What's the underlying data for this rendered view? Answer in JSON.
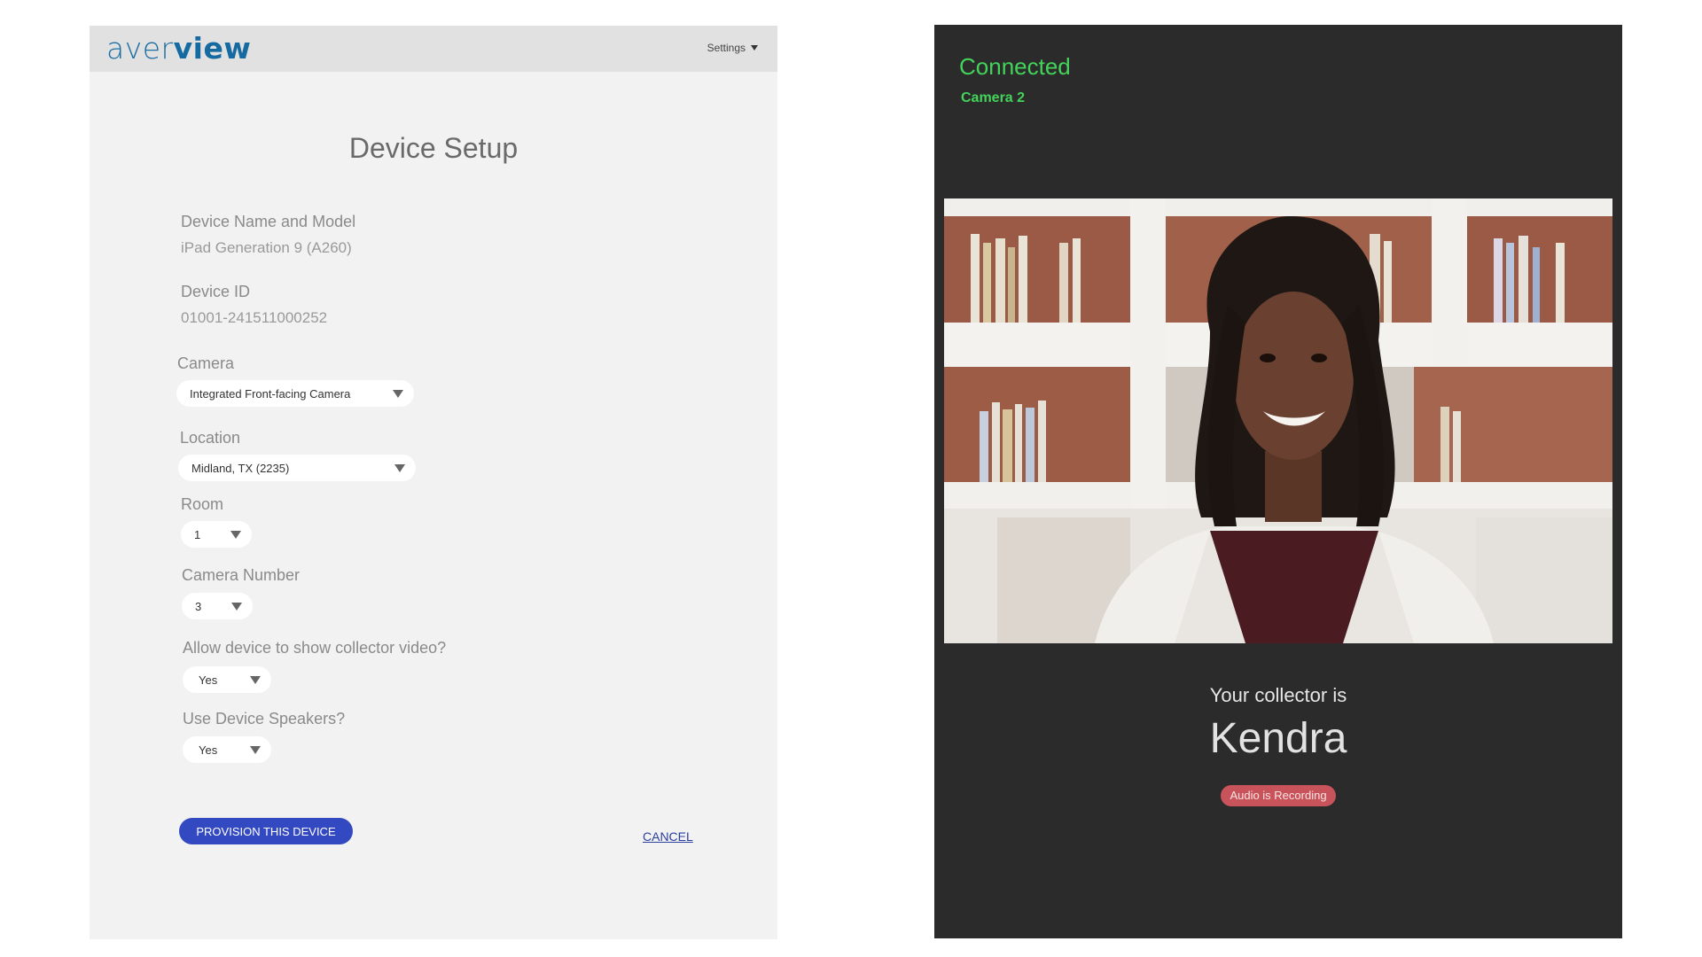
{
  "setup": {
    "logo": {
      "light": "aver",
      "bold": "view"
    },
    "settings_label": "Settings",
    "title": "Device Setup",
    "device_name": {
      "label": "Device Name and Model",
      "value": "iPad Generation 9 (A260)"
    },
    "device_id": {
      "label": "Device ID",
      "value": "01001-241511000252"
    },
    "camera": {
      "label": "Camera",
      "value": "Integrated Front-facing Camera"
    },
    "location": {
      "label": "Location",
      "value": "Midland, TX (2235)"
    },
    "room": {
      "label": "Room",
      "value": "1"
    },
    "camera_number": {
      "label": "Camera Number",
      "value": "3"
    },
    "show_video": {
      "label": "Allow device to show collector video?",
      "value": "Yes"
    },
    "speakers": {
      "label": "Use Device Speakers?",
      "value": "Yes"
    },
    "provision_label": "PROVISION THIS DEVICE",
    "cancel_label": "CANCEL"
  },
  "collector": {
    "status": "Connected",
    "camera": "Camera 2",
    "intro": "Your collector is",
    "name": "Kendra",
    "recording_badge": "Audio is Recording"
  },
  "colors": {
    "brand_blue": "#1d6fa3",
    "primary_button": "#3349c1",
    "connected_green": "#44d35a",
    "recording_red": "#c9535a",
    "dark_panel": "#2b2b2b"
  },
  "icons": [
    "chevron-down-icon"
  ]
}
